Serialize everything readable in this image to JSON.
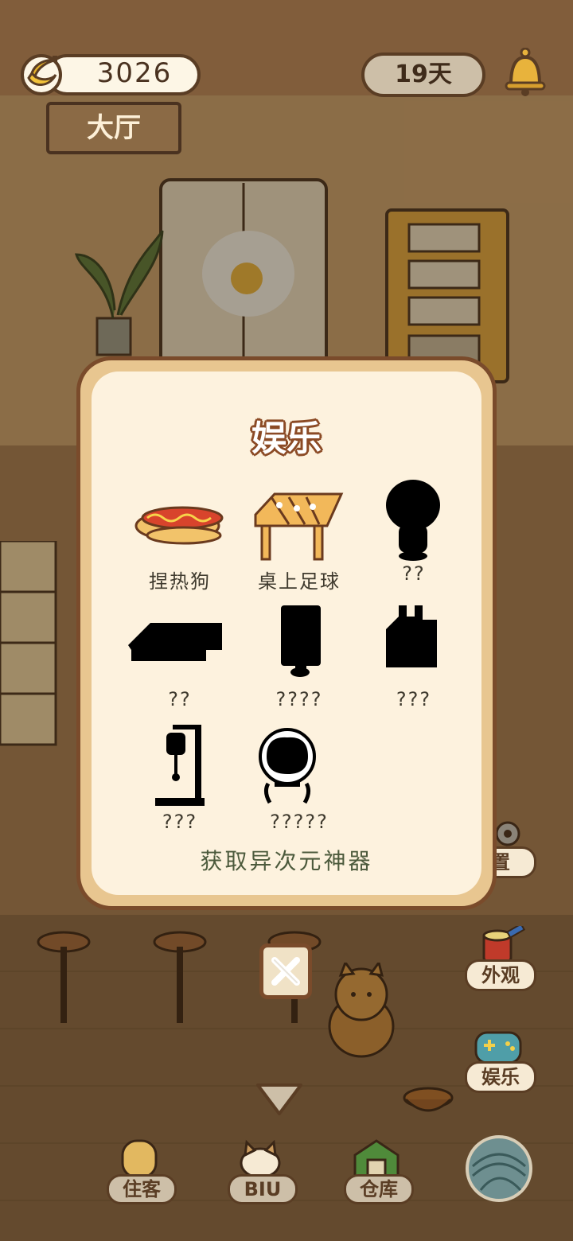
{
  "hud": {
    "currency_value": "3026",
    "currency_icon": "banana-icon",
    "room_name": "大厅",
    "days_label": "19天",
    "bell_icon": "bell-icon"
  },
  "side_buttons": [
    {
      "label": "置",
      "icon": "gear-icon"
    },
    {
      "label": "外观",
      "icon": "paint-bucket-icon"
    },
    {
      "label": "娱乐",
      "icon": "gamepad-icon"
    }
  ],
  "bottom_nav": [
    {
      "label": "住客",
      "icon": "guest-icon"
    },
    {
      "label": "BIU",
      "icon": "cat-face-icon"
    },
    {
      "label": "仓库",
      "icon": "warehouse-icon"
    },
    {
      "label": "",
      "icon": "yarn-ball-icon"
    }
  ],
  "modal": {
    "title": "娱乐",
    "items": [
      {
        "name": "捏热狗",
        "icon": "hotdog-toy-icon",
        "unlocked": true
      },
      {
        "name": "桌上足球",
        "icon": "foosball-table-icon",
        "unlocked": true
      },
      {
        "name": "??",
        "icon": "locked-silhouette-icon",
        "unlocked": false
      },
      {
        "name": "??",
        "icon": "locked-silhouette-icon",
        "unlocked": false
      },
      {
        "name": "????",
        "icon": "locked-silhouette-icon",
        "unlocked": false
      },
      {
        "name": "???",
        "icon": "locked-silhouette-icon",
        "unlocked": false
      },
      {
        "name": "???",
        "icon": "locked-silhouette-icon",
        "unlocked": false
      },
      {
        "name": "?????",
        "icon": "locked-silhouette-icon",
        "unlocked": false
      }
    ],
    "footer": "获取异次元神器",
    "close_icon": "close-icon"
  },
  "colors": {
    "modal_border": "#7a4b2b",
    "modal_fill": "#fdf2de",
    "title_outline": "#8b4a25"
  }
}
